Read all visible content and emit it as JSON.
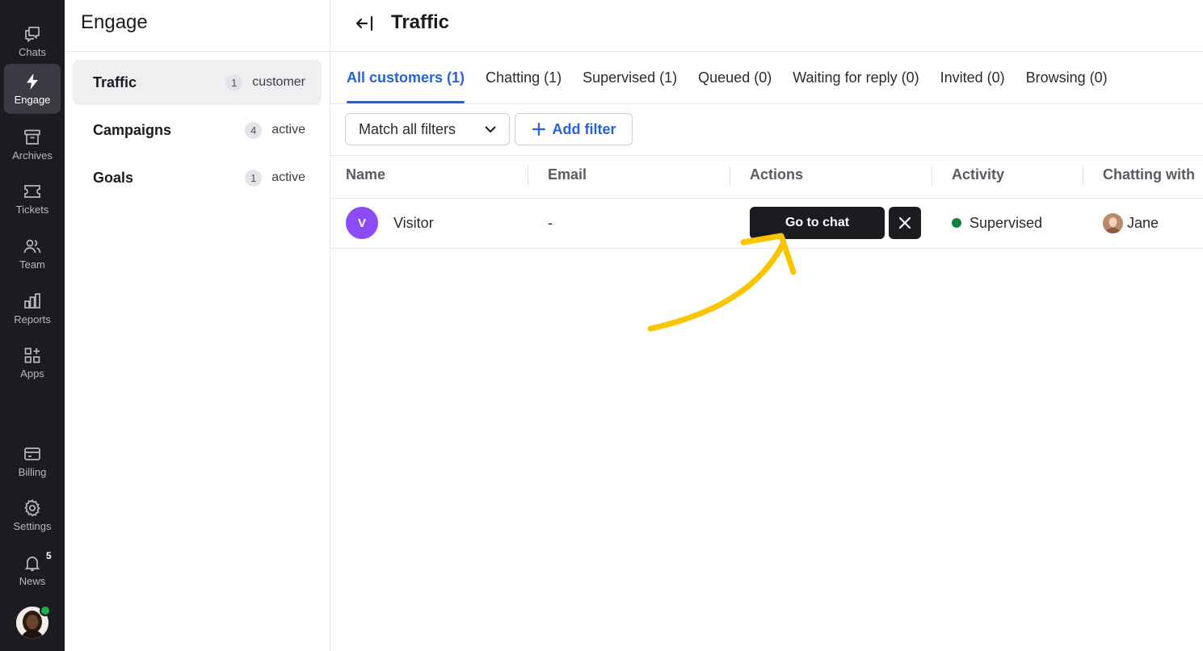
{
  "rail": {
    "items": [
      {
        "label": "Chats",
        "icon": "chat-icon"
      },
      {
        "label": "Engage",
        "icon": "bolt-icon"
      },
      {
        "label": "Archives",
        "icon": "archive-icon"
      },
      {
        "label": "Tickets",
        "icon": "ticket-icon"
      },
      {
        "label": "Team",
        "icon": "team-icon"
      },
      {
        "label": "Reports",
        "icon": "reports-icon"
      },
      {
        "label": "Apps",
        "icon": "apps-icon"
      },
      {
        "label": "Billing",
        "icon": "billing-icon"
      },
      {
        "label": "Settings",
        "icon": "gear-icon"
      },
      {
        "label": "News",
        "icon": "bell-icon",
        "badge": "5"
      }
    ],
    "active": "Engage"
  },
  "section": {
    "title": "Engage",
    "items": [
      {
        "label": "Traffic",
        "count": "1",
        "suffix": "customer"
      },
      {
        "label": "Campaigns",
        "count": "4",
        "suffix": "active"
      },
      {
        "label": "Goals",
        "count": "1",
        "suffix": "active"
      }
    ]
  },
  "main": {
    "title": "Traffic",
    "tabs": [
      {
        "label": "All customers (1)"
      },
      {
        "label": "Chatting (1)"
      },
      {
        "label": "Supervised (1)"
      },
      {
        "label": "Queued (0)"
      },
      {
        "label": "Waiting for reply (0)"
      },
      {
        "label": "Invited (0)"
      },
      {
        "label": "Browsing (0)"
      }
    ],
    "filter_select": "Match all filters",
    "add_filter": "Add filter",
    "columns": [
      "Name",
      "Email",
      "Actions",
      "Activity",
      "Chatting with"
    ],
    "rows": [
      {
        "avatar_initial": "V",
        "name": "Visitor",
        "email": "-",
        "action_label": "Go to chat",
        "activity": "Supervised",
        "chatting_with": "Jane"
      }
    ]
  },
  "colors": {
    "accent": "#2662d9",
    "rail_bg": "#1b1b20",
    "visitor_avatar": "#8b4cf6",
    "status_green": "#12833a",
    "annotation_arrow": "#f7c600"
  }
}
